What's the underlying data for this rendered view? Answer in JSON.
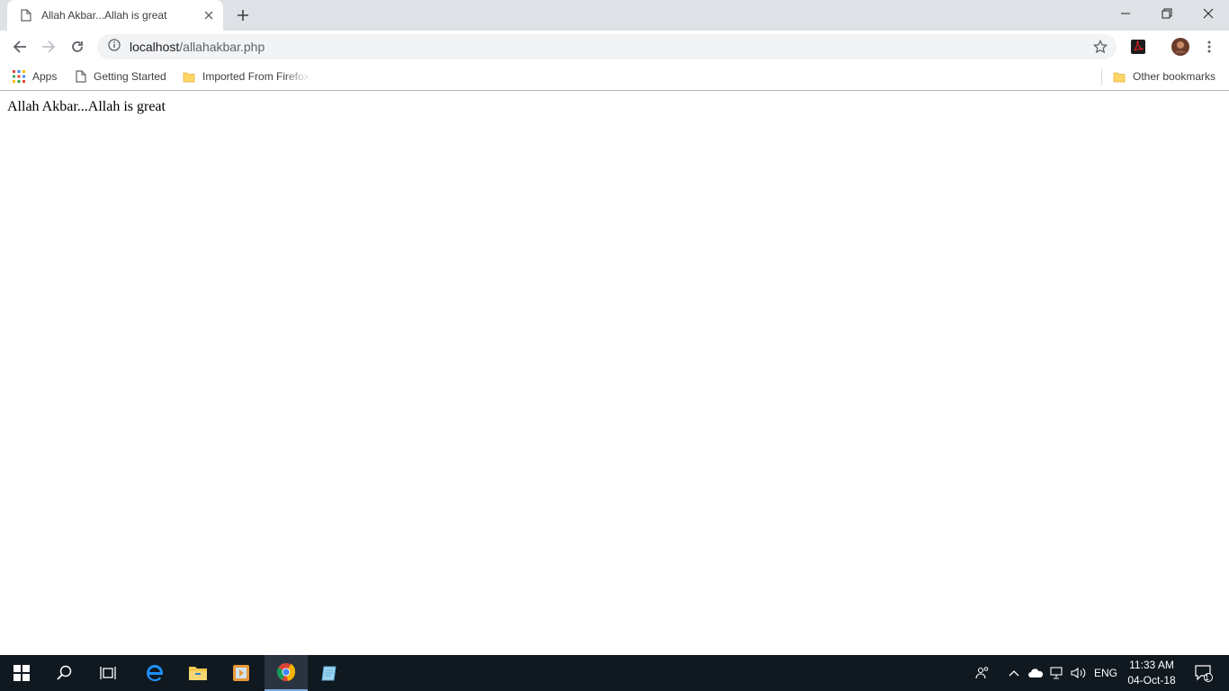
{
  "tab": {
    "title": "Allah Akbar...Allah is great"
  },
  "omnibox": {
    "host": "localhost",
    "path": "/allahakbar.php"
  },
  "bookmarks": {
    "apps": "Apps",
    "getting_started": "Getting Started",
    "imported": "Imported From Firefox",
    "other": "Other bookmarks"
  },
  "page": {
    "body_text": "Allah Akbar...Allah is great"
  },
  "taskbar": {
    "language": "ENG",
    "time": "11:33 AM",
    "date": "04-Oct-18",
    "notification_count": "1"
  },
  "colors": {
    "tabstrip": "#dee1e6",
    "taskbar": "#101820",
    "accent": "#1a73e8"
  },
  "icons": [
    "page-icon",
    "close-icon",
    "plus-icon",
    "minimize-icon",
    "restore-icon",
    "back-icon",
    "forward-icon",
    "reload-icon",
    "info-icon",
    "star-icon",
    "pdf-icon",
    "avatar",
    "menu-icon",
    "apps-grid-icon",
    "folder-icon",
    "windows-icon",
    "search-icon",
    "task-view-icon",
    "edge-icon",
    "file-explorer-icon",
    "media-player-icon",
    "chrome-icon",
    "notepad-icon",
    "people-icon",
    "chevron-up-icon",
    "onedrive-icon",
    "network-icon",
    "volume-icon",
    "action-center-icon"
  ]
}
